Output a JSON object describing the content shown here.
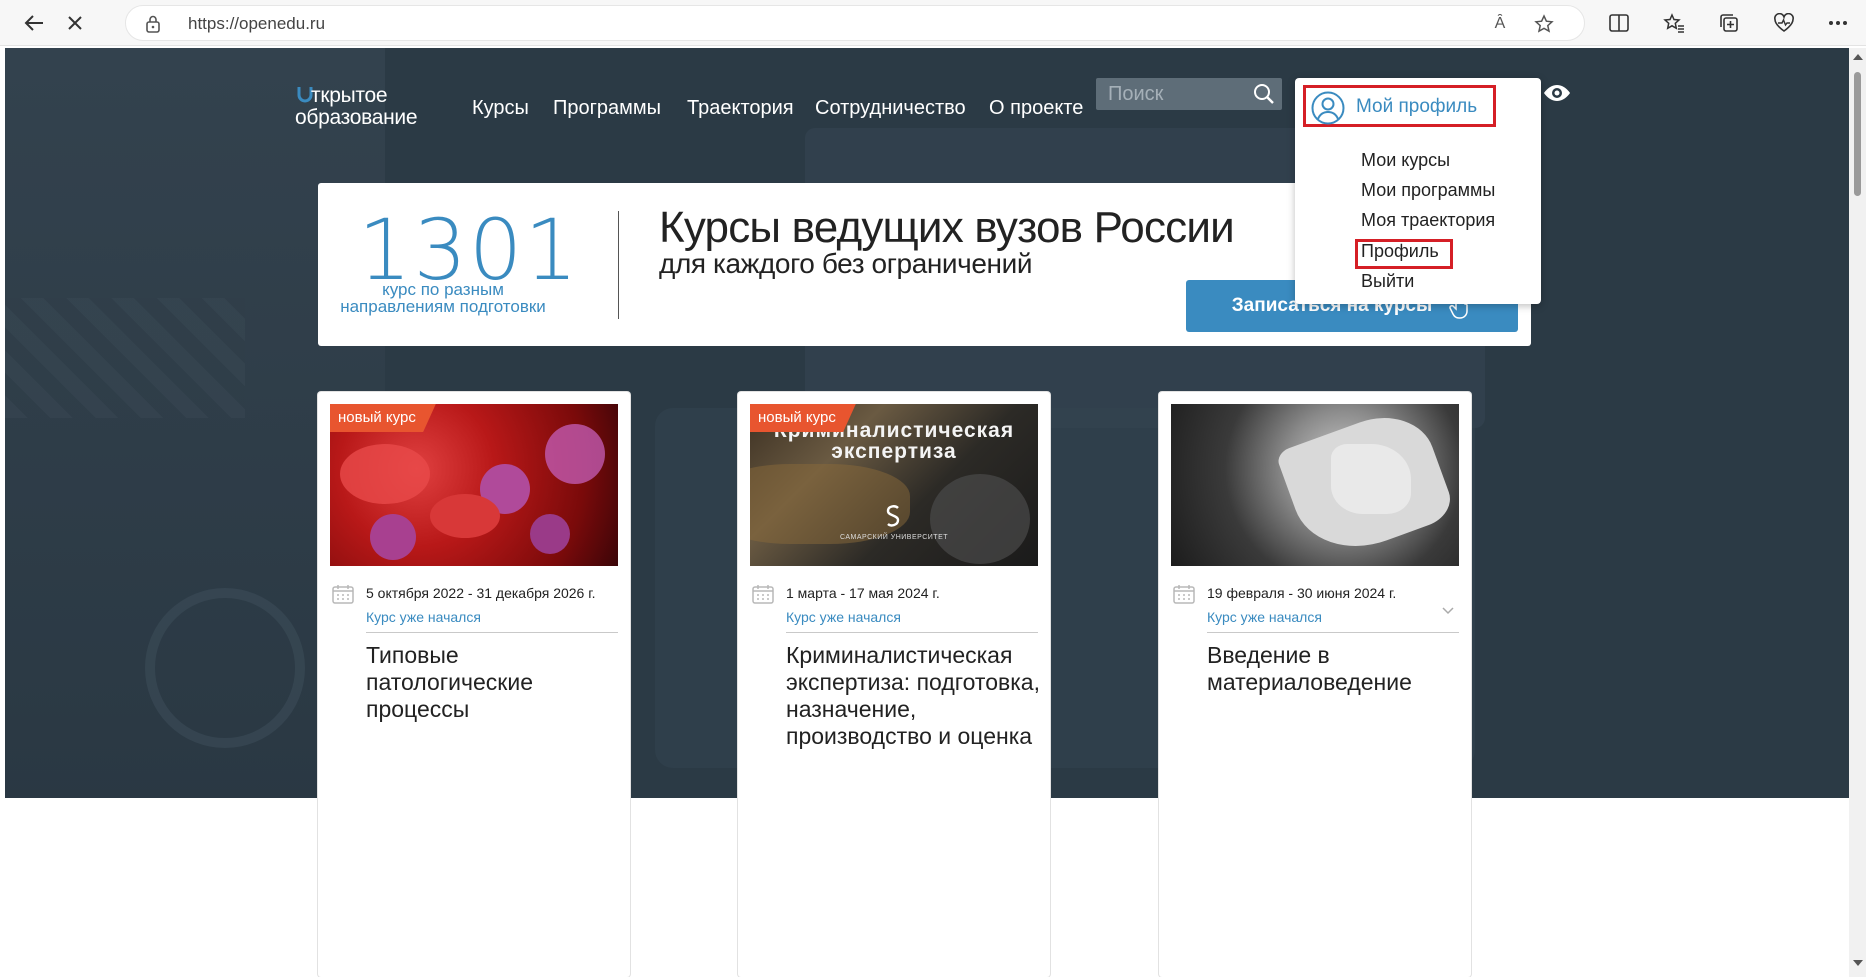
{
  "browser": {
    "url": "https://openedu.ru",
    "read_aloud_label": "Ȃ",
    "icons": [
      "back-arrow-icon",
      "close-icon",
      "lock-icon",
      "read-aloud-icon",
      "favorite-star-icon",
      "split-screen-icon",
      "favorites-icon",
      "collections-icon",
      "health-icon",
      "more-icon"
    ]
  },
  "header": {
    "logo_line1": "ткрытое",
    "logo_line2": "образование",
    "menu": [
      "Курсы",
      "Программы",
      "Траектория",
      "Сотрудничество",
      "О проекте"
    ],
    "search_placeholder": "Поиск"
  },
  "banner": {
    "count": "1301",
    "count_caption_line1": "курс по разным",
    "count_caption_line2": "направлениям подготовки",
    "title": "Курсы ведущих вузов России",
    "subtitle": "для каждого без ограничений",
    "enroll_button": "Записаться на курсы"
  },
  "dropdown": {
    "profile_label": "Мой профиль",
    "items": [
      "Мои курсы",
      "Мои программы",
      "Моя траектория",
      "Профиль",
      "Выйти"
    ]
  },
  "cards": [
    {
      "badge": "новый курс",
      "date": "5 октября 2022 - 31 декабря 2026 г.",
      "status": "Курс уже начался",
      "title": "Типовые патологические процессы"
    },
    {
      "badge": "новый курс",
      "image_title_line1": "Криминалистическая",
      "image_title_line2": "экспертиза",
      "image_univ": "САМАРСКИЙ УНИВЕРСИТЕТ",
      "date": "1 марта - 17 мая 2024 г.",
      "status": "Курс уже начался",
      "title": "Криминалистическая экспертиза: подготовка, назначение, производство и оценка"
    },
    {
      "date": "19 февраля - 30 июня 2024 г.",
      "status": "Курс уже начался",
      "title": "Введение в материаловедение"
    }
  ],
  "colors": {
    "accent": "#3a8bc0",
    "badge": "#e8552f",
    "highlight": "#d51f26",
    "hero_bg": "#2b3a45"
  }
}
